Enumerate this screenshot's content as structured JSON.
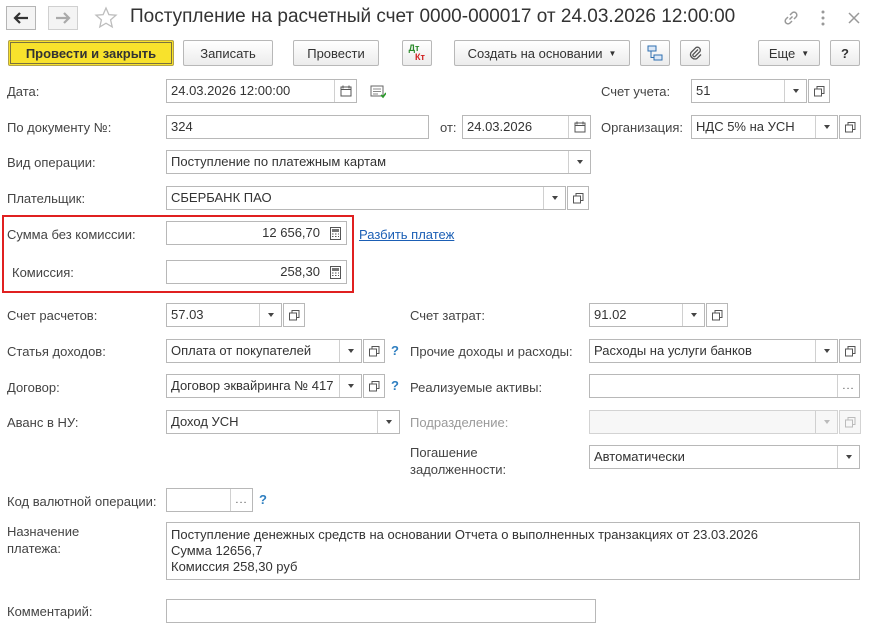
{
  "window": {
    "title": "Поступление на расчетный счет 0000-000017 от 24.03.2026 12:00:00"
  },
  "toolbar": {
    "post_close": "Провести и закрыть",
    "save": "Записать",
    "post": "Провести",
    "dtkt_top": "Дт",
    "dtkt_bottom": "Кт",
    "create_based": "Создать на основании",
    "more": "Еще",
    "help": "?"
  },
  "form": {
    "date": {
      "label": "Дата:",
      "value": "24.03.2026 12:00:00"
    },
    "account": {
      "label": "Счет учета:",
      "value": "51"
    },
    "doc_number": {
      "label": "По документу №:",
      "value": "324"
    },
    "doc_date": {
      "label": "от:",
      "value": "24.03.2026"
    },
    "organization": {
      "label": "Организация:",
      "value": "НДС 5% на УСН"
    },
    "operation": {
      "label": "Вид операции:",
      "value": "Поступление по платежным картам"
    },
    "payer": {
      "label": "Плательщик:",
      "value": "СБЕРБАНК ПАО"
    },
    "amount": {
      "label": "Сумма без комиссии:",
      "value": "12 656,70"
    },
    "split_link": "Разбить платеж",
    "commission": {
      "label": "Комиссия:",
      "value": "258,30"
    },
    "settlement_account": {
      "label": "Счет расчетов:",
      "value": "57.03"
    },
    "expense_account": {
      "label": "Счет затрат:",
      "value": "91.02"
    },
    "income_item": {
      "label": "Статья доходов:",
      "value": "Оплата от покупателей"
    },
    "other_income": {
      "label": "Прочие доходы и расходы:",
      "value": "Расходы на услуги банков"
    },
    "contract": {
      "label": "Договор:",
      "value": "Договор эквайринга № 417"
    },
    "sold_assets": {
      "label": "Реализуемые активы:",
      "value": ""
    },
    "advance": {
      "label": "Аванс в НУ:",
      "value": "Доход УСН"
    },
    "department": {
      "label": "Подразделение:",
      "value": ""
    },
    "debt_repayment": {
      "label_line1": "Погашение",
      "label_line2": "задолженности:",
      "value": "Автоматически"
    },
    "currency_code": {
      "label": "Код валютной операции:",
      "value": ""
    },
    "purpose": {
      "label_line1": "Назначение",
      "label_line2": "платежа:",
      "lines": [
        "Поступление денежных средств на основании Отчета о выполненных транзакциях от 23.03.2026",
        "Сумма 12656,7",
        "Комиссия 258,30 руб"
      ]
    },
    "comment": {
      "label": "Комментарий:",
      "value": ""
    },
    "help_mark": "?"
  },
  "colors": {
    "primary_button": "#f8e22c",
    "highlight_frame": "#e02020",
    "link": "#1b5fb5",
    "help": "#2f7fc0"
  }
}
